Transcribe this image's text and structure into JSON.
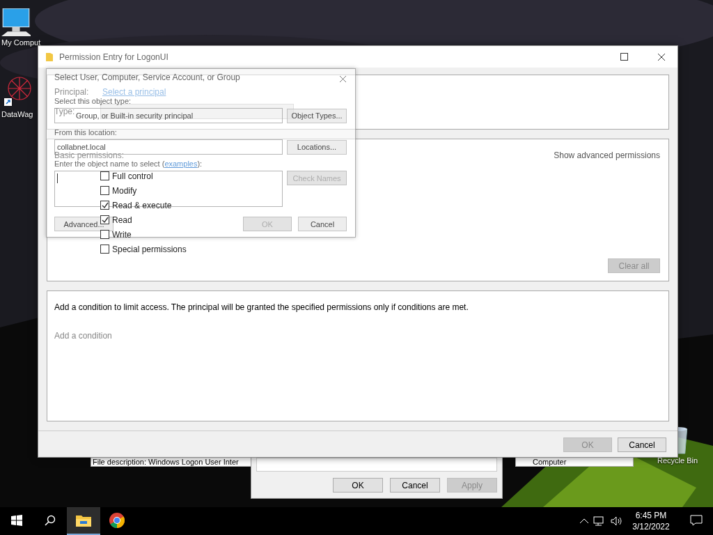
{
  "desktop_icons": [
    {
      "label": "My Comput",
      "kind": "computer"
    },
    {
      "label": "DataWag",
      "kind": "app"
    },
    {
      "label": "Recycle Bin",
      "kind": "bin"
    }
  ],
  "background_windows": {
    "description": "File description: Windows Logon User Inter",
    "item": "Computer",
    "buttons": [
      {
        "label": "OK",
        "disabled": false
      },
      {
        "label": "Cancel",
        "disabled": false
      },
      {
        "label": "Apply",
        "disabled": true
      }
    ]
  },
  "permission_window": {
    "title": "Permission Entry for LogonUI",
    "principal_label": "Principal:",
    "principal_link": "Select a principal",
    "type_label": "Type:",
    "basic_permissions_label": "Basic permissions:",
    "show_advanced": "Show advanced permissions",
    "permissions": [
      {
        "label": "Full control",
        "checked": false
      },
      {
        "label": "Modify",
        "checked": false
      },
      {
        "label": "Read & execute",
        "checked": true
      },
      {
        "label": "Read",
        "checked": true
      },
      {
        "label": "Write",
        "checked": false
      },
      {
        "label": "Special permissions",
        "checked": false
      }
    ],
    "clear_all": {
      "label": "Clear all",
      "disabled": true
    },
    "condition_text": "Add a condition to limit access. The principal will be granted the specified permissions only if conditions are met.",
    "add_condition": "Add a condition",
    "buttons": [
      {
        "label": "OK",
        "disabled": true
      },
      {
        "label": "Cancel",
        "disabled": false
      }
    ]
  },
  "select_dialog": {
    "title": "Select User, Computer, Service Account, or Group",
    "object_type_label": "Select this object type:",
    "object_type": "Group, or Built-in security principal",
    "object_types_button": "Object Types...",
    "location_label": "From this location:",
    "location": "collabnet.local",
    "locations_button": "Locations...",
    "enter_label": "Enter the object name to select (",
    "examples_link": "examples",
    "enter_label_end": "):",
    "check_names": {
      "label": "Check Names",
      "disabled": true
    },
    "advanced": {
      "label": "Advanced...",
      "disabled": false
    },
    "buttons": [
      {
        "label": "OK",
        "disabled": true
      },
      {
        "label": "Cancel",
        "disabled": false
      }
    ]
  },
  "taskbar": {
    "apps": [
      {
        "kind": "explorer",
        "selected": true
      },
      {
        "kind": "chrome",
        "selected": false
      }
    ],
    "time": "6:45 PM",
    "date": "3/12/2022"
  }
}
